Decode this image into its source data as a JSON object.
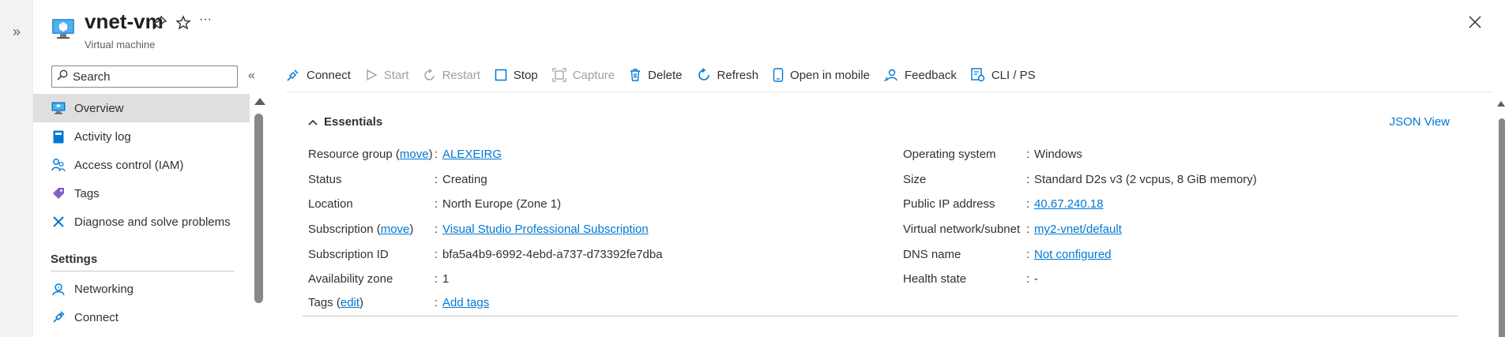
{
  "header": {
    "title": "vnet-vm",
    "subtitle": "Virtual machine",
    "pin_icon": "pin-icon",
    "favorite_icon": "star-icon",
    "more_label": "···",
    "close_icon": "close-icon",
    "expand_label": "»"
  },
  "sidebar": {
    "search_placeholder": "Search",
    "collapse_label": "«",
    "items": [
      {
        "label": "Overview",
        "icon": "monitor-icon",
        "active": true
      },
      {
        "label": "Activity log",
        "icon": "book-icon"
      },
      {
        "label": "Access control (IAM)",
        "icon": "people-icon"
      },
      {
        "label": "Tags",
        "icon": "tag-icon"
      },
      {
        "label": "Diagnose and solve problems",
        "icon": "wrench-icon"
      }
    ],
    "section_settings": "Settings",
    "settings_items": [
      {
        "label": "Networking",
        "icon": "network-icon"
      },
      {
        "label": "Connect",
        "icon": "plug-icon"
      }
    ]
  },
  "toolbar": {
    "connect": "Connect",
    "start": "Start",
    "restart": "Restart",
    "stop": "Stop",
    "capture": "Capture",
    "delete": "Delete",
    "refresh": "Refresh",
    "open_mobile": "Open in mobile",
    "feedback": "Feedback",
    "cli": "CLI / PS"
  },
  "essentials": {
    "title": "Essentials",
    "json_view": "JSON View",
    "left": {
      "resource_group_key": "Resource group",
      "move": "move",
      "resource_group_value": "ALEXEIRG",
      "status_key": "Status",
      "status_value": "Creating",
      "location_key": "Location",
      "location_value": "North Europe (Zone 1)",
      "subscription_key": "Subscription",
      "subscription_value": "Visual Studio Professional Subscription",
      "subscription_id_key": "Subscription ID",
      "subscription_id_value": "bfa5a4b9-6992-4ebd-a737-d73392fe7dba",
      "availability_zone_key": "Availability zone",
      "availability_zone_value": "1"
    },
    "right": {
      "os_key": "Operating system",
      "os_value": "Windows",
      "size_key": "Size",
      "size_value": "Standard D2s v3 (2 vcpus, 8 GiB memory)",
      "public_ip_key": "Public IP address",
      "public_ip_value": "40.67.240.18",
      "vnet_key": "Virtual network/subnet",
      "vnet_value": "my2-vnet/default",
      "dns_key": "DNS name",
      "dns_value": "Not configured",
      "health_key": "Health state",
      "health_value": "-"
    },
    "tags_key": "Tags",
    "tags_edit": "edit",
    "tags_value": "Add tags",
    "separator": ":",
    "paren_open": "(",
    "paren_close": ")"
  },
  "colors": {
    "accent": "#0078d4",
    "text": "#323130",
    "disabled": "#a19f9d",
    "active_nav": "#e1dfdd"
  }
}
